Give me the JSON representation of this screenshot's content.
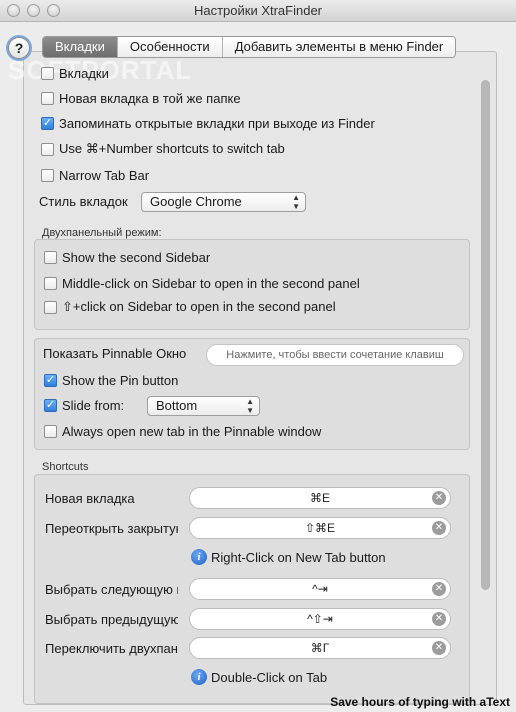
{
  "window": {
    "title": "Настройки XtraFinder"
  },
  "help_label": "?",
  "tabs": [
    {
      "label": "Вкладки"
    },
    {
      "label": "Особенности"
    },
    {
      "label": "Добавить элементы в меню Finder"
    }
  ],
  "watermark": "SOFTPORTAL",
  "general": {
    "tabs": {
      "label": "Вкладки",
      "checked": false
    },
    "new_tab_same_folder": {
      "label": "Новая вкладка в той же папке",
      "checked": false
    },
    "remember_tabs": {
      "label": "Запоминать открытые вкладки при выходе из Finder",
      "checked": true
    },
    "cmd_number": {
      "label": "Use ⌘+Number shortcuts to switch tab",
      "checked": false
    },
    "narrow_tab_bar": {
      "label": "Narrow Tab Bar",
      "checked": false
    },
    "tab_style_label": "Стиль вкладок",
    "tab_style_value": "Google Chrome"
  },
  "dual_panel": {
    "header": "Двухпанельный режим:",
    "show_second_sidebar": {
      "label": "Show the second Sidebar",
      "checked": false
    },
    "middle_click": {
      "label": "Middle-click on Sidebar to open in the second panel",
      "checked": false
    },
    "shift_click": {
      "label": "⇧+click on Sidebar to open in the second panel",
      "checked": false
    }
  },
  "pinnable": {
    "label": "Показать Pinnable Окно",
    "shortcut_placeholder": "Нажмите, чтобы ввести сочетание клавиш",
    "show_pin": {
      "label": "Show the Pin button",
      "checked": true
    },
    "slide_from": {
      "label": "Slide from:",
      "checked": true
    },
    "slide_from_value": "Bottom",
    "always_open": {
      "label": "Always open new tab in the Pinnable window",
      "checked": false
    }
  },
  "shortcuts": {
    "header": "Shortcuts",
    "items": [
      {
        "label": "Новая вкладка",
        "keys": "⌘E"
      },
      {
        "label": "Переоткрыть закрытую вкладку",
        "keys": "⇧⌘E"
      },
      {
        "label": "Выбрать следующую вкладку",
        "keys": "^⇥"
      },
      {
        "label": "Выбрать предыдущую вкладку",
        "keys": "^⇧⇥"
      },
      {
        "label": "Переключить двухпанельный режим",
        "keys": "⌘Г"
      }
    ],
    "hint_new_tab": "Right-Click on New Tab button",
    "hint_dual": "Double-Click on Tab"
  },
  "banner": "Save hours of typing with aText",
  "colors": {
    "accent": "#2f7fdb",
    "tab_active": "#7a7a7a"
  }
}
